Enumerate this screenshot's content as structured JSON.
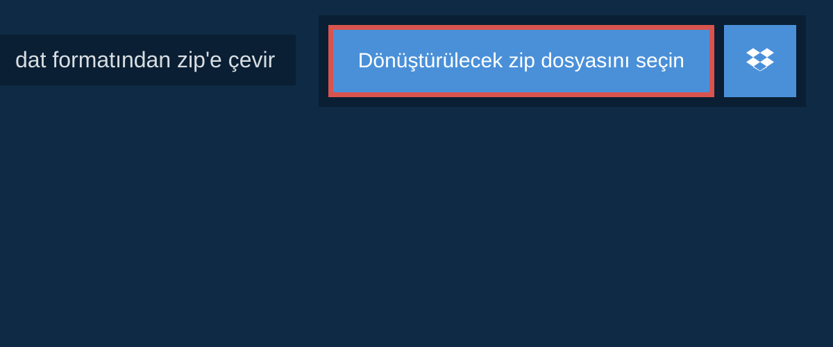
{
  "header": {
    "title": "dat formatından zip'e çevir"
  },
  "actions": {
    "select_file_label": "Dönüştürülecek zip dosyasını seçin"
  },
  "colors": {
    "background": "#0f2a44",
    "panel": "#0a1f33",
    "button": "#4a90d9",
    "highlight_border": "#d9544f",
    "text_light": "#d8dde2",
    "text_white": "#ffffff"
  }
}
